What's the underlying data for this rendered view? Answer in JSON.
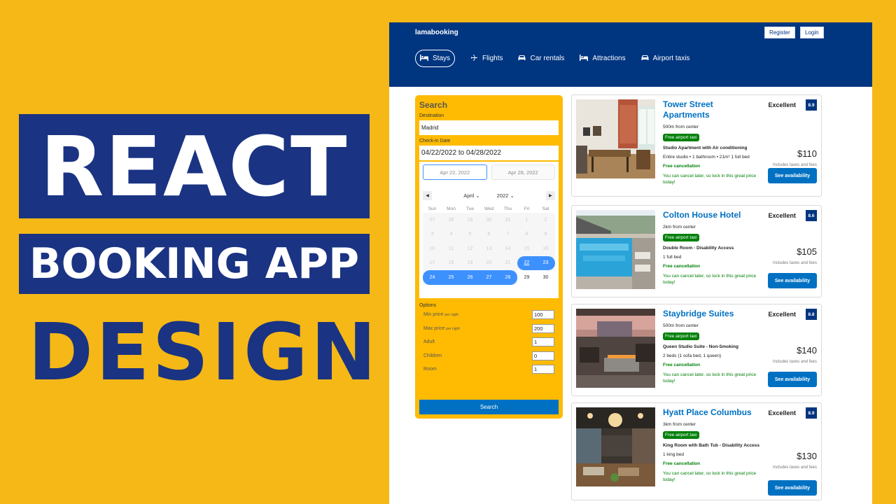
{
  "banner": {
    "line1": "REACT",
    "line2": "BOOKING APP",
    "line3": "DESIGN"
  },
  "header": {
    "logo": "lamabooking",
    "register": "Register",
    "login": "Login",
    "nav": [
      {
        "label": "Stays",
        "icon": "bed-icon",
        "active": true
      },
      {
        "label": "Flights",
        "icon": "plane-icon"
      },
      {
        "label": "Car rentals",
        "icon": "car-icon"
      },
      {
        "label": "Attractions",
        "icon": "bed-icon"
      },
      {
        "label": "Airport taxis",
        "icon": "taxi-icon"
      }
    ]
  },
  "search": {
    "title": "Search",
    "destination_label": "Destination",
    "destination_value": "Madrid",
    "checkin_label": "Check-in Date",
    "checkin_value": "04/22/2022 to 04/28/2022",
    "range_start": "Apr 22, 2022",
    "range_end": "Apr 28, 2022",
    "month": "April",
    "year": "2022",
    "prev_arrow": "◀",
    "next_arrow": "▶",
    "weekdays": [
      "Sun",
      "Mon",
      "Tue",
      "Wed",
      "Thu",
      "Fri",
      "Sat"
    ],
    "options_label": "Options",
    "options": [
      {
        "label": "Min price",
        "small": "per night",
        "value": "100"
      },
      {
        "label": "Max price",
        "small": "per night",
        "value": "200"
      },
      {
        "label": "Adult",
        "small": "",
        "value": "1"
      },
      {
        "label": "Children",
        "small": "",
        "value": "0"
      },
      {
        "label": "Room",
        "small": "",
        "value": "1"
      }
    ],
    "button": "Search"
  },
  "results": [
    {
      "title": "Tower Street Apartments",
      "distance": "500m from center",
      "taxi": "Free airport taxi",
      "subtitle": "Studio Apartment with Air conditioning",
      "features": "Entire studio • 1 bathroom • 21m² 1 full bed",
      "cancel": "Free cancellation",
      "cancel_sub": "You can cancel later, so lock in this great price today!",
      "rating_text": "Excellent",
      "score": "8.9",
      "price": "$110",
      "tax": "Includes taxes and fees",
      "button": "See availability"
    },
    {
      "title": "Colton House Hotel",
      "distance": "2km from center",
      "taxi": "Free airport taxi",
      "subtitle": "Double Room - Disability Access",
      "features": "1 full bed",
      "cancel": "Free cancellation",
      "cancel_sub": "You can cancel later, so lock in this great price today!",
      "rating_text": "Excellent",
      "score": "8.6",
      "price": "$105",
      "tax": "Includes taxes and fees",
      "button": "See availability"
    },
    {
      "title": "Staybridge Suites",
      "distance": "500m from center",
      "taxi": "Free airport taxi",
      "subtitle": "Queen Studio Suite - Non-Smoking",
      "features": "2 beds (1 sofa bed, 1 queen)",
      "cancel": "Free cancellation",
      "cancel_sub": "You can cancel later, so lock in this great price today!",
      "rating_text": "Excellent",
      "score": "8.8",
      "price": "$140",
      "tax": "Includes taxes and fees",
      "button": "See availability"
    },
    {
      "title": "Hyatt Place Columbus",
      "distance": "3km from center",
      "taxi": "Free airport taxi",
      "subtitle": "King Room with Bath Tub - Disability Access",
      "features": "1 king bed",
      "cancel": "Free cancellation",
      "cancel_sub": "You can cancel later, so lock in this great price today!",
      "rating_text": "Excellent",
      "score": "8.9",
      "price": "$130",
      "tax": "Includes taxes and fees",
      "button": "See availability"
    }
  ],
  "calendar_days": [
    [
      "27",
      "28",
      "29",
      "30",
      "31",
      "1",
      "2"
    ],
    [
      "3",
      "4",
      "5",
      "6",
      "7",
      "8",
      "9"
    ],
    [
      "10",
      "11",
      "12",
      "13",
      "14",
      "15",
      "16"
    ],
    [
      "17",
      "18",
      "19",
      "20",
      "21",
      "22",
      "23"
    ],
    [
      "24",
      "25",
      "26",
      "27",
      "28",
      "29",
      "30"
    ]
  ]
}
